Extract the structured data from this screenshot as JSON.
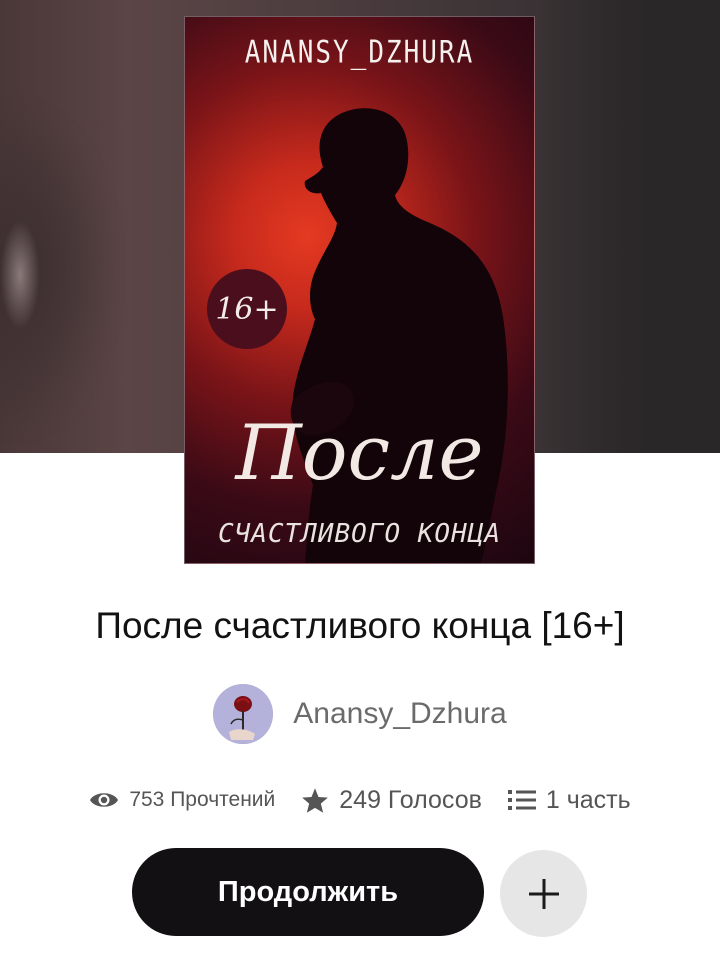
{
  "cover": {
    "author_text": "ANANSY_DZHURA",
    "age_badge": "16+",
    "title_script": "После",
    "subtitle": "СЧАСТЛИВОГО КОНЦА"
  },
  "book": {
    "title": "После счастливого конца [16+]"
  },
  "author": {
    "name": "Anansy_Dzhura",
    "avatar_icon": "rose-avatar"
  },
  "stats": {
    "reads_label": "753 Прочтений",
    "votes_label": "249 Голосов",
    "parts_label": "1 часть",
    "reads_icon": "eye-icon",
    "votes_icon": "star-icon",
    "parts_icon": "list-icon"
  },
  "actions": {
    "continue_label": "Продолжить",
    "add_icon": "plus-icon"
  },
  "colors": {
    "primary_button": "#121013",
    "secondary_button": "#e6e6e6",
    "text": "#121212",
    "muted_text": "#6b6b6b"
  }
}
